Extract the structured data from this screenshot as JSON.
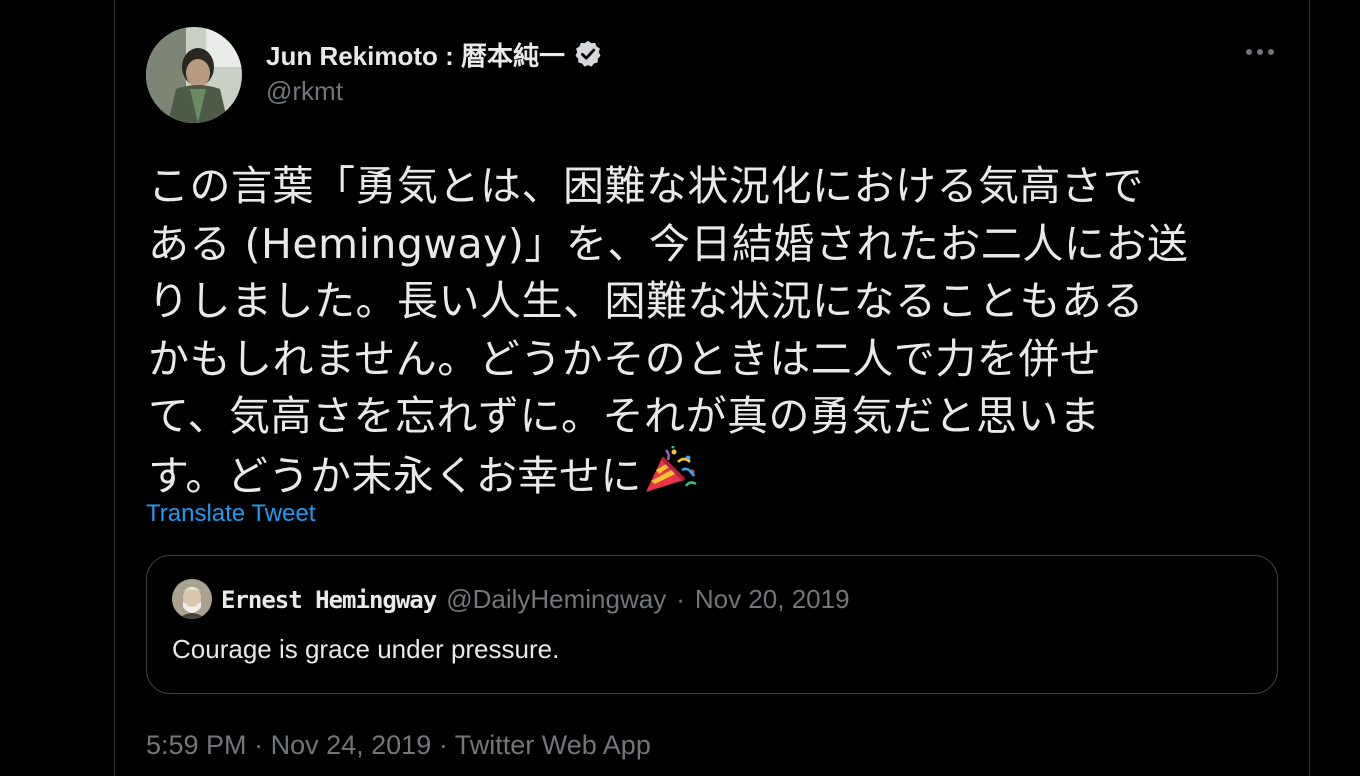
{
  "tweet": {
    "author": {
      "display_name": "Jun Rekimoto : 暦本純一",
      "handle": "@rkmt",
      "verified": true,
      "avatar_icon": "user-avatar-photo"
    },
    "more_icon": "more-horizontal-icon",
    "text_lines": [
      "この言葉「勇気とは、困難な状況化における気高さで",
      "ある (Hemingway)」を、今日結婚されたお二人にお送",
      "りしました。長い人生、困難な状況になることもある",
      "かもしれません。どうかそのときは二人で力を併せ",
      "て、気高さを忘れずに。それが真の勇気だと思いま",
      "す。どうか末永くお幸せに"
    ],
    "emoji": "party-popper-icon",
    "translate_label": "Translate Tweet",
    "quoted": {
      "display_name": "Ernest Hemingway",
      "handle": "@DailyHemingway",
      "separator": "·",
      "date": "Nov 20, 2019",
      "text": "Courage is grace under pressure."
    },
    "meta": {
      "time": "5:59 PM",
      "separator": "·",
      "date": "Nov 24, 2019",
      "app": "Twitter Web App"
    }
  },
  "colors": {
    "background": "#000000",
    "text_primary": "#e7e9ea",
    "text_secondary": "#71767b",
    "link": "#1d9bf0",
    "border": "#2f3336"
  }
}
